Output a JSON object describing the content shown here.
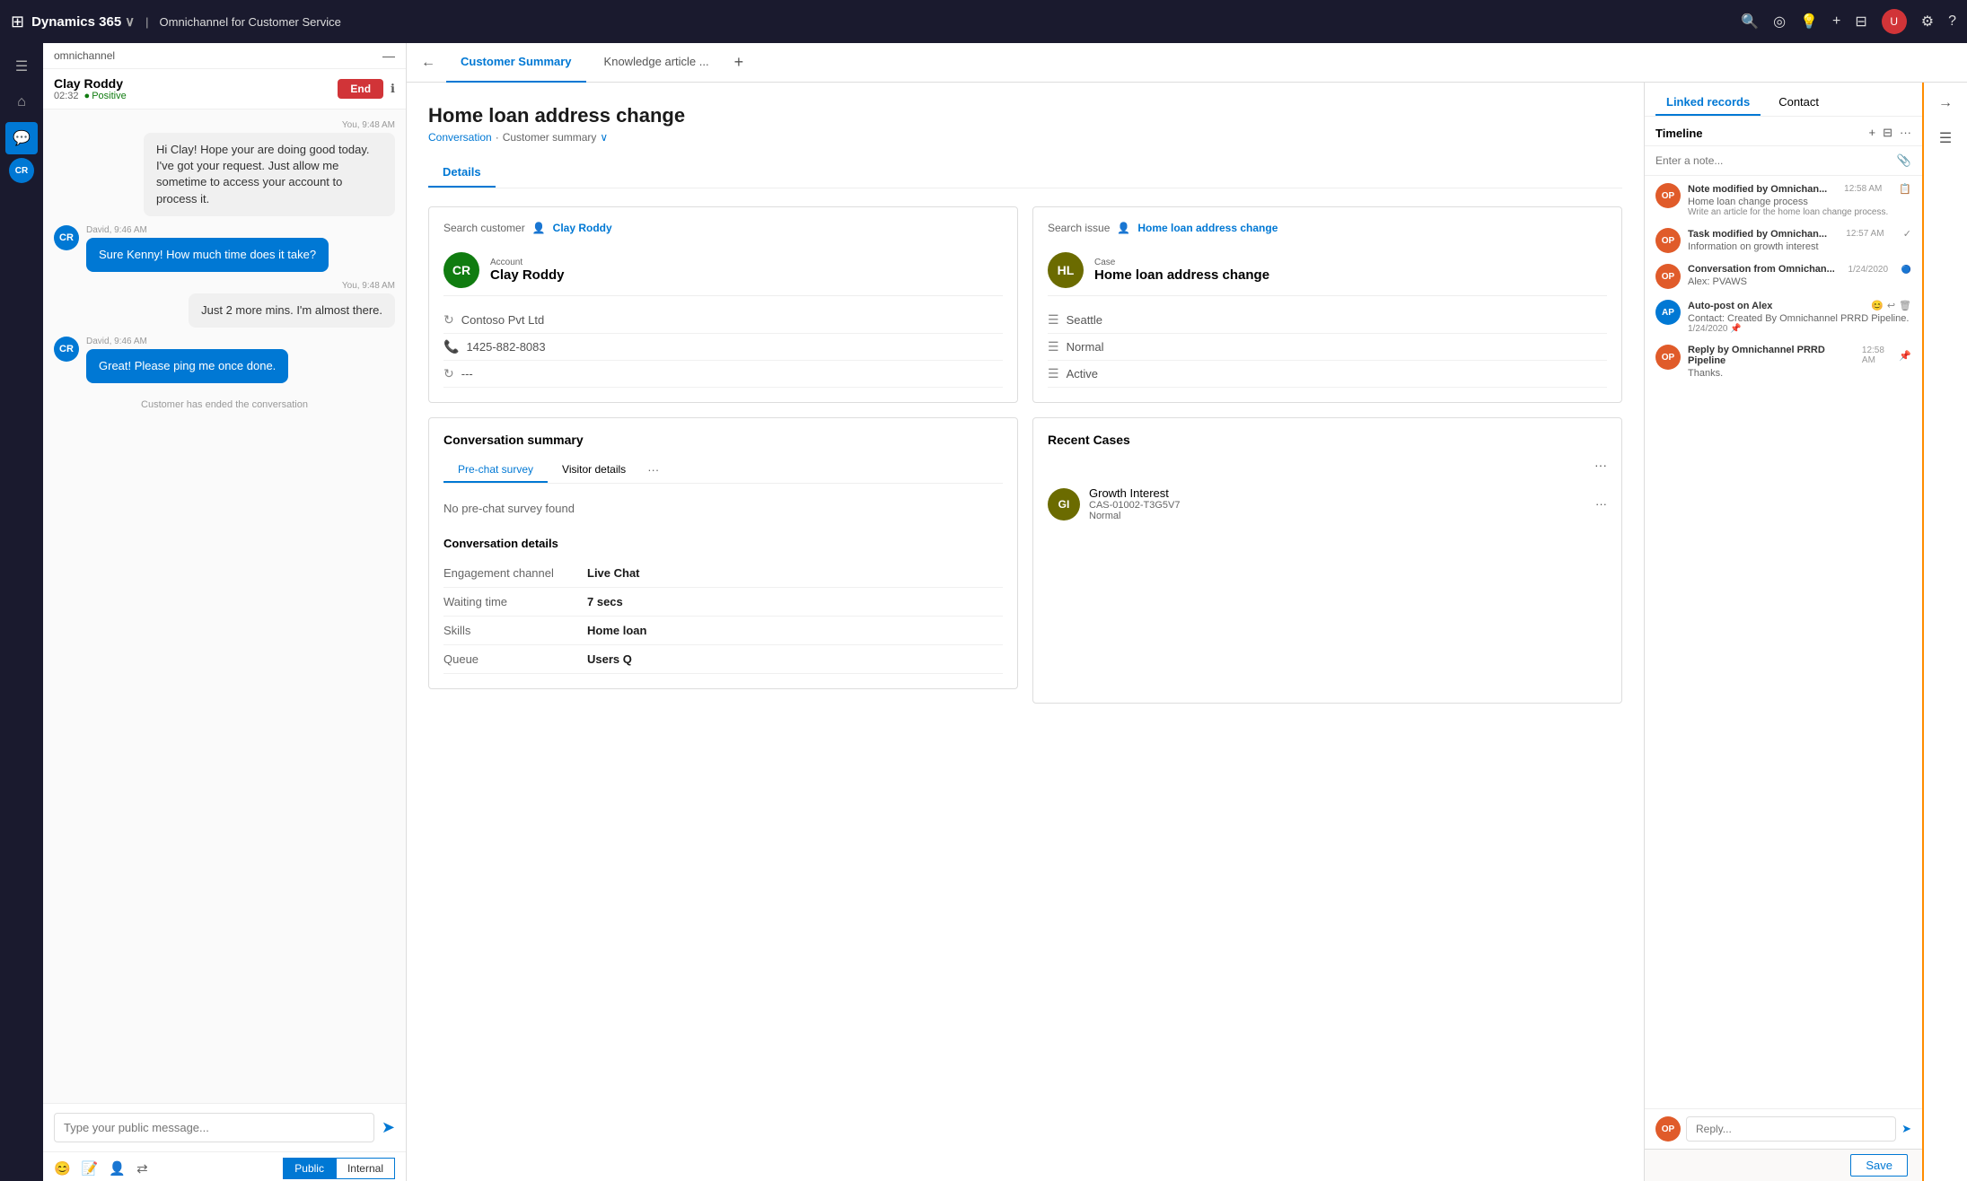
{
  "app": {
    "name": "Dynamics 365",
    "subtitle": "Omnichannel for Customer Service"
  },
  "topnav": {
    "search_icon": "🔍",
    "notifications_icon": "🔔",
    "help_icon": "?",
    "settings_icon": "⚙",
    "add_icon": "+",
    "filter_icon": "⊞",
    "user_avatar_bg": "#d13438"
  },
  "sidebar": {
    "search_label": "omnichannel",
    "home_icon": "⌂",
    "chat_icon": "💬",
    "cr_label": "CR"
  },
  "chat": {
    "contact_name": "Clay Roddy",
    "duration": "02:32",
    "sentiment": "Positive",
    "end_button": "End",
    "messages": [
      {
        "id": 1,
        "type": "agent",
        "timestamp": "You, 9:48 AM",
        "text": "Hi Clay! Hope your are doing good today. I've got your request. Just allow me sometime to access your account to process it."
      },
      {
        "id": 2,
        "type": "customer",
        "timestamp": "David, 9:46 AM",
        "text": "Sure Kenny! How much time does it take?",
        "avatar_bg": "#0078d4",
        "initials": "CR"
      },
      {
        "id": 3,
        "type": "agent",
        "timestamp": "You, 9:48 AM",
        "text": "Just 2 more mins. I'm almost there."
      },
      {
        "id": 4,
        "type": "customer",
        "timestamp": "David, 9:46 AM",
        "text": "Great! Please ping me once done.",
        "avatar_bg": "#0078d4",
        "initials": "CR"
      }
    ],
    "system_message": "Customer has ended the conversation",
    "input_placeholder": "Type your public message...",
    "mode_public": "Public",
    "mode_internal": "Internal"
  },
  "tabs": {
    "customer_summary": "Customer Summary",
    "knowledge_article": "Knowledge article ...",
    "add_tab": "+"
  },
  "page": {
    "title": "Home loan address change",
    "breadcrumb_conversation": "Conversation",
    "breadcrumb_summary": "Customer summary"
  },
  "details_tab": "Details",
  "customer_card": {
    "search_label": "Search customer",
    "search_value": "Clay Roddy",
    "account_label": "Account",
    "entity_name": "Clay Roddy",
    "entity_initials": "CR",
    "entity_bg": "#107c10",
    "company": "Contoso Pvt Ltd",
    "phone": "1425-882-8083",
    "extra": "---"
  },
  "case_card": {
    "search_label": "Search issue",
    "search_value": "Home loan address change",
    "case_label": "Case",
    "case_name": "Home loan address change",
    "case_initials": "HL",
    "case_bg": "#6b6b00",
    "location": "Seattle",
    "priority": "Normal",
    "status": "Active"
  },
  "conversation_summary": {
    "title": "Conversation summary",
    "tab_prechat": "Pre-chat survey",
    "tab_visitor": "Visitor details",
    "no_survey": "No pre-chat survey found",
    "details_title": "Conversation details",
    "fields": [
      {
        "label": "Engagement channel",
        "value": "Live Chat"
      },
      {
        "label": "Waiting time",
        "value": "7 secs"
      },
      {
        "label": "Skills",
        "value": "Home loan"
      },
      {
        "label": "Queue",
        "value": "Users Q"
      }
    ]
  },
  "recent_cases": {
    "title": "Recent Cases",
    "items": [
      {
        "name": "Growth Interest",
        "id": "CAS-01002-T3G5V7",
        "priority": "Normal",
        "initials": "GI",
        "bg": "#6b6b00"
      }
    ]
  },
  "right_panel": {
    "tab_linked": "Linked records",
    "tab_contact": "Contact",
    "timeline_title": "Timeline",
    "note_placeholder": "Enter a note...",
    "items": [
      {
        "title": "Note modified by Omnichan...",
        "time": "12:58 AM",
        "desc": "Home loan change process",
        "sub": "Write an article for the home loan change process.",
        "initials": "OP",
        "bg": "#e05b2a",
        "icon": "📋"
      },
      {
        "title": "Task modified by Omnichan...",
        "time": "12:57 AM",
        "desc": "Information on growth interest",
        "sub": "",
        "initials": "OP",
        "bg": "#e05b2a",
        "icon": "✓"
      },
      {
        "title": "Conversation from Omnichan...",
        "time": "1/24/2020",
        "desc": "Alex: PVAWS",
        "sub": "",
        "initials": "OP",
        "bg": "#e05b2a",
        "icon": "🔵"
      },
      {
        "title": "Auto-post on Alex",
        "time": "1/24/2020",
        "desc": "Contact: Created By Omnichannel PRRD Pipeline.",
        "sub": "",
        "initials": "AP",
        "bg": "#0078d4",
        "icon": ""
      },
      {
        "title": "Reply by Omnichannel PRRD Pipeline",
        "time": "12:58 AM",
        "desc": "Thanks.",
        "sub": "",
        "initials": "OP",
        "bg": "#e05b2a",
        "icon": "📋"
      }
    ],
    "reply_placeholder": "Reply...",
    "save_label": "Save"
  }
}
